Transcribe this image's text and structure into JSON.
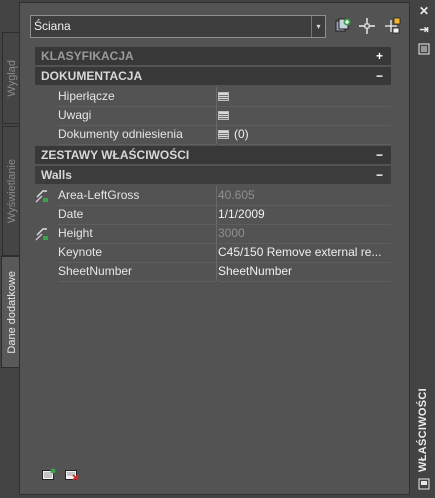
{
  "palette": {
    "title": "WŁAŚCIWOŚCI",
    "close_glyph": "✕",
    "autohide_glyph": "⇥",
    "properties_glyph": "≡"
  },
  "side_tabs": [
    {
      "label": "Wygląd",
      "active": false
    },
    {
      "label": "Wyświetlanie",
      "active": false
    },
    {
      "label": "Dane dodatkowe",
      "active": true
    }
  ],
  "selector": {
    "value": "Ściana",
    "arrow": "▾"
  },
  "toolbar": {
    "quick_select_icon": "quick-select-icon",
    "select_objects_icon": "select-objects-icon",
    "toggle_pickadd_icon": "toggle-pickadd-icon"
  },
  "categories": {
    "klasyfikacja": {
      "label": "KLASYFIKACJA",
      "toggle": "+"
    },
    "dokumentacja": {
      "label": "DOKUMENTACJA",
      "toggle": "−",
      "rows": [
        {
          "name": "Hiperłącze",
          "value": ""
        },
        {
          "name": "Uwagi",
          "value": ""
        },
        {
          "name": "Dokumenty odniesienia",
          "value": "(0)"
        }
      ]
    },
    "zestawy": {
      "label": "ZESTAWY WŁAŚCIWOŚCI",
      "toggle": "−"
    },
    "walls": {
      "label": "Walls",
      "toggle": "−",
      "rows": [
        {
          "name": "Area-LeftGross",
          "value": "40.605",
          "readonly": true,
          "formula": true
        },
        {
          "name": "Date",
          "value": "1/1/2009",
          "readonly": false,
          "formula": false
        },
        {
          "name": "Height",
          "value": "3000",
          "readonly": true,
          "formula": true
        },
        {
          "name": "Keynote",
          "value": "C45/150 Remove external re...",
          "readonly": false,
          "formula": false
        },
        {
          "name": "SheetNumber",
          "value": "SheetNumber",
          "readonly": false,
          "formula": false
        }
      ]
    }
  },
  "bottom_icons": [
    "attach-property-set-icon",
    "remove-property-set-icon"
  ],
  "colors": {
    "palette_bg": "#434343",
    "panel_bg": "#535353",
    "category_bg": "#383838",
    "text": "#e6e6e6",
    "readonly_text": "#8f8f8f"
  }
}
